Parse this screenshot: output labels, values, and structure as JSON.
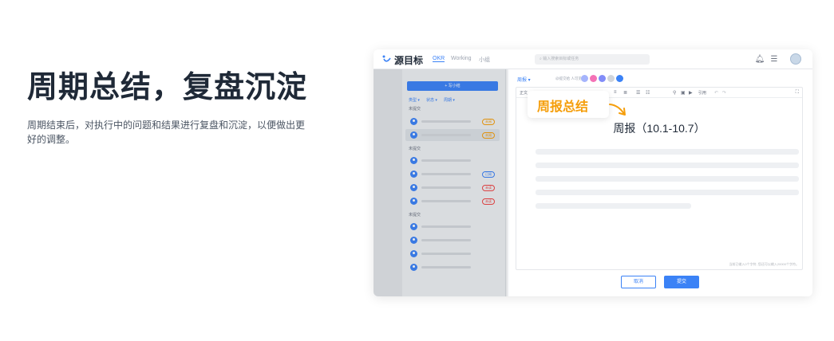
{
  "hero": {
    "title": "周期总结，复盘沉淀",
    "description": "周期结束后，对执行中的问题和结果进行复盘和沉淀，以便做出更好的调整。"
  },
  "app": {
    "logo_text": "源目标",
    "nav": [
      "OKR",
      "Working",
      "小组"
    ],
    "search_placeholder": "输入搜索目标或任务",
    "accent_color": "#3b82f6",
    "icons": [
      "bell-icon",
      "tasks-icon",
      "avatar"
    ]
  },
  "sidebar": {
    "new_button": "+ 写小结",
    "filters": [
      "类型 ▾",
      "状态 ▾",
      "周期 ▾"
    ],
    "groups": [
      {
        "label": "未提交",
        "rows": [
          {
            "tag": "未阅",
            "selected": false
          },
          {
            "tag": "未阅",
            "selected": true
          }
        ]
      },
      {
        "label": "未提交",
        "rows": [
          {
            "tag": "",
            "selected": false
          },
          {
            "tag": "已阅",
            "selected": false
          },
          {
            "tag": "未读",
            "selected": false
          },
          {
            "tag": "未读",
            "selected": false
          }
        ]
      },
      {
        "label": "未提交",
        "rows": [
          {
            "tag": "",
            "selected": false
          },
          {
            "tag": "",
            "selected": false
          },
          {
            "tag": "",
            "selected": false
          },
          {
            "tag": "",
            "selected": false
          }
        ]
      }
    ]
  },
  "editor": {
    "type_select": "周报 ▾",
    "share_hint": "@提交给 人可见",
    "toolbar_first": "正文",
    "toolbar_quote": "引用",
    "callout": "周报总结",
    "doc_title": "周报（10.1-10.7）",
    "counter": "当前已输入0个字符, 您还可以输入20000个字符。",
    "cancel": "取消",
    "submit": "提交"
  }
}
